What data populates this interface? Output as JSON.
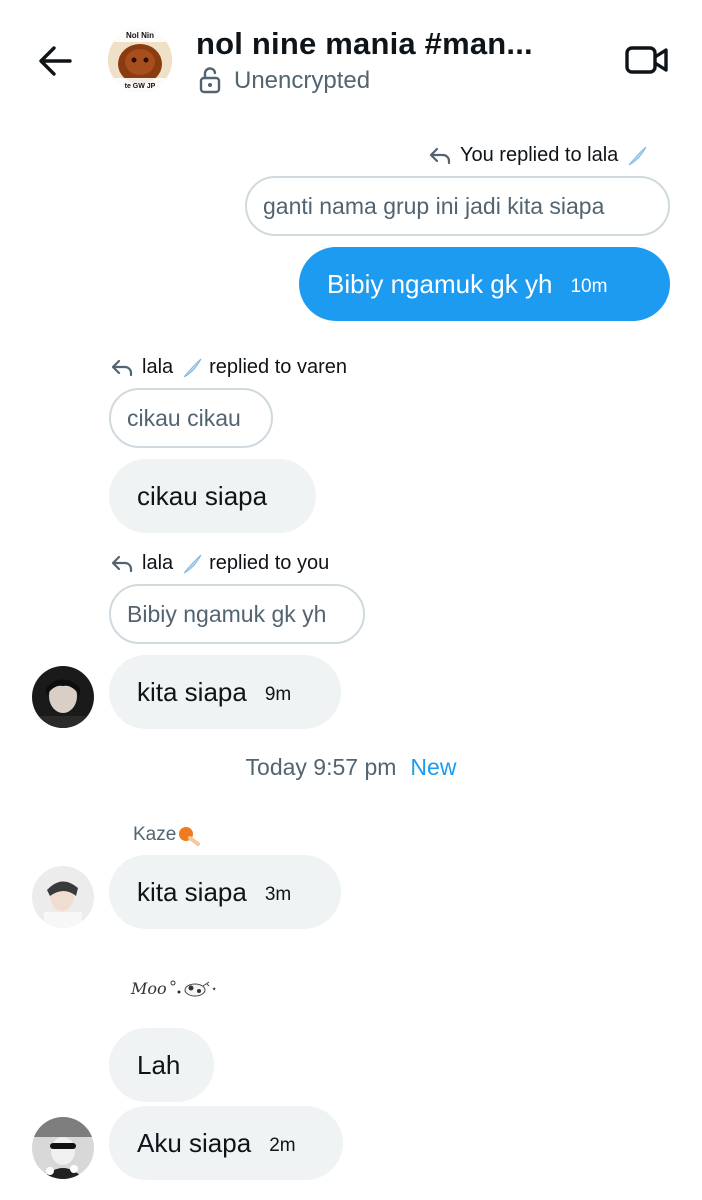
{
  "header": {
    "title": "nol nine mania #man...",
    "encryption_status": "Unencrypted",
    "avatar_text_top": "Nol Nin",
    "avatar_text_bottom": "te GW JP"
  },
  "messages": {
    "m1": {
      "reply_context": "You replied to lala",
      "quoted_text": "ganti nama grup ini jadi kita siapa",
      "text": "Bibiy ngamuk gk yh",
      "time": "10m"
    },
    "m2": {
      "reply_name": "lala",
      "reply_suffix": "replied to varen",
      "quoted_text": "cikau cikau",
      "text": "cikau siapa"
    },
    "m3": {
      "reply_name": "lala",
      "reply_suffix": "replied to you",
      "quoted_text": "Bibiy ngamuk gk yh",
      "text": "kita siapa",
      "time": "9m"
    },
    "divider": {
      "datetime": "Today 9:57 pm",
      "new_label": "New"
    },
    "m4": {
      "sender": "Kaze",
      "text": "kita siapa",
      "time": "3m"
    },
    "m5": {
      "sender": "Moo",
      "text1": "Lah",
      "text2": "Aku siapa",
      "time": "2m"
    }
  },
  "colors": {
    "accent": "#1d9bf0",
    "bubble_in": "#eff3f4",
    "muted_text": "#536471",
    "border": "#cfd9de"
  },
  "icons": [
    "back-arrow-icon",
    "unlock-icon",
    "video-call-icon",
    "reply-arrow-icon",
    "feather-icon",
    "orange-emoji-icon",
    "cow-emoji-icon"
  ]
}
